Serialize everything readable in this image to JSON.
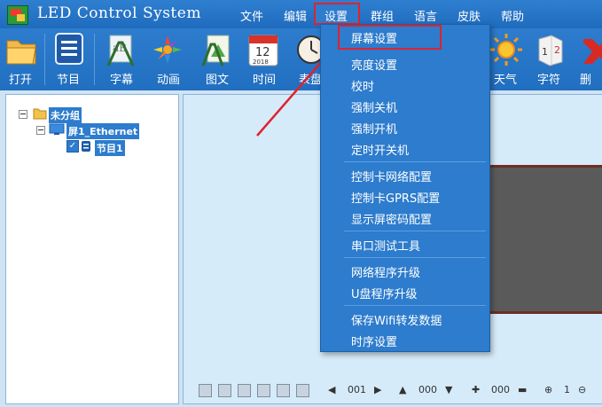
{
  "app": {
    "title": "LED Control System"
  },
  "menu": [
    "文件",
    "编辑",
    "设置",
    "群组",
    "语言",
    "皮肤",
    "帮助"
  ],
  "toolbar": {
    "items": [
      "打开",
      "节目",
      "字幕",
      "动画",
      "图文",
      "时间",
      "表盘",
      "天气",
      "字符",
      "删"
    ]
  },
  "tree": {
    "group": "未分组",
    "screen": "屏1_Ethernet",
    "program": "节目1"
  },
  "dropdown": {
    "items": [
      "屏幕设置",
      "亮度设置",
      "校时",
      "强制关机",
      "强制开机",
      "定时开关机",
      "控制卡网络配置",
      "控制卡GPRS配置",
      "显示屏密码配置",
      "串口测试工具",
      "网络程序升级",
      "U盘程序升级",
      "保存Wifi转发数据",
      "时序设置"
    ]
  },
  "statusbar": {
    "page": "001",
    "value2": "000",
    "value3": "000",
    "zoom": "1"
  },
  "colors": {
    "accent": "#2d7ccd",
    "highlight": "#e0222f"
  }
}
